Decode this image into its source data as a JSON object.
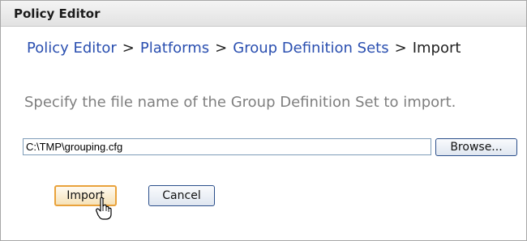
{
  "window": {
    "title": "Policy Editor"
  },
  "breadcrumb": {
    "items": [
      "Policy Editor",
      "Platforms",
      "Group Definition Sets"
    ],
    "separator": ">",
    "current": "Import"
  },
  "form": {
    "instruction": "Specify the file name of the Group Definition Set to import.",
    "file_path": "C:\\TMP\\grouping.cfg",
    "browse_label": "Browse...",
    "import_label": "Import",
    "cancel_label": "Cancel"
  },
  "colors": {
    "link": "#2a4fb0",
    "instruction_text": "#7f7f7f",
    "focus_border": "#e9a23b",
    "button_border": "#2a4e8a"
  },
  "icons": {
    "pointer": "hand-pointer-cursor"
  }
}
